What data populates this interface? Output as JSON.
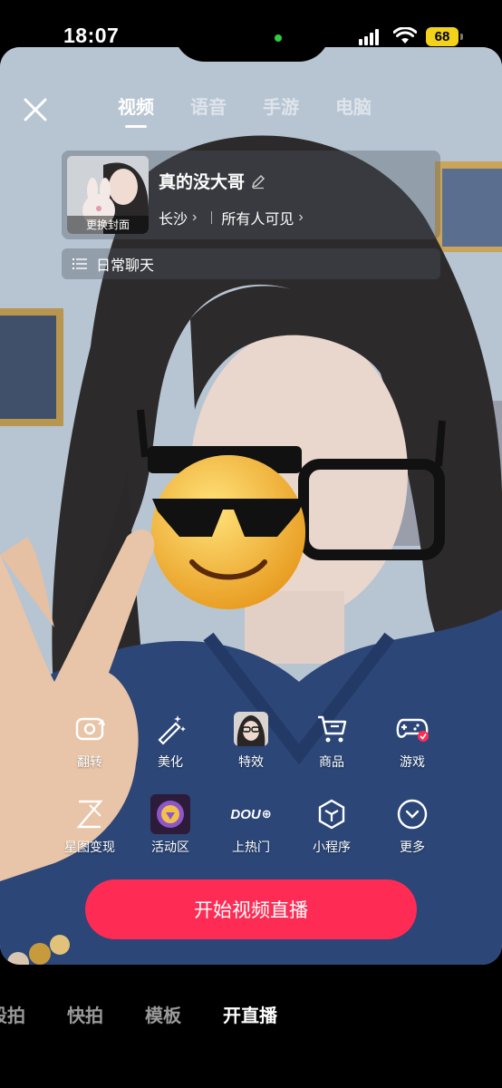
{
  "status": {
    "time": "18:07",
    "battery": "68"
  },
  "mode_tabs": [
    {
      "label": "视频",
      "active": true
    },
    {
      "label": "语音",
      "active": false
    },
    {
      "label": "手游",
      "active": false
    },
    {
      "label": "电脑",
      "active": false
    }
  ],
  "info": {
    "cover_label": "更换封面",
    "title": "真的没大哥",
    "location": "长沙",
    "visibility": "所有人可见",
    "topic": "日常聊天"
  },
  "tools_row1": [
    {
      "label": "翻转",
      "icon": "flip-camera-icon"
    },
    {
      "label": "美化",
      "icon": "magic-wand-icon"
    },
    {
      "label": "特效",
      "icon": "effect-thumbnail-icon"
    },
    {
      "label": "商品",
      "icon": "shopping-cart-icon"
    },
    {
      "label": "游戏",
      "icon": "gamepad-icon"
    }
  ],
  "tools_row2": [
    {
      "label": "星图变现",
      "icon": "star-map-icon"
    },
    {
      "label": "活动区",
      "icon": "activity-badge-icon"
    },
    {
      "label": "上热门",
      "icon": "dou-plus-icon",
      "logo_text": "DOU"
    },
    {
      "label": "小程序",
      "icon": "mini-program-icon"
    },
    {
      "label": "更多",
      "icon": "more-chevron-icon"
    }
  ],
  "start_button": "开始视频直播",
  "bottom_modes": [
    {
      "label": "段拍",
      "active": false
    },
    {
      "label": "快拍",
      "active": false
    },
    {
      "label": "模板",
      "active": false
    },
    {
      "label": "开直播",
      "active": true
    }
  ],
  "colors": {
    "accent": "#fe2c55",
    "battery": "#f2d21b"
  }
}
